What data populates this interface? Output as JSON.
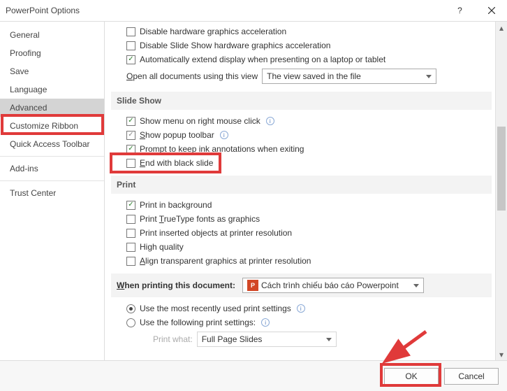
{
  "window": {
    "title": "PowerPoint Options"
  },
  "sidebar": {
    "items": [
      "General",
      "Proofing",
      "Save",
      "Language",
      "Advanced",
      "Customize Ribbon",
      "Quick Access Toolbar",
      "Add-ins",
      "Trust Center"
    ],
    "selected": "Advanced"
  },
  "top": {
    "disable_hw": "Disable hardware graphics acceleration",
    "disable_ss_hw": "Disable Slide Show hardware graphics acceleration",
    "auto_extend": "Automatically extend display when presenting on a laptop or tablet",
    "open_view_label_pre": "O",
    "open_view_label_rest": "pen all documents using this view",
    "open_view_value": "The view saved in the file"
  },
  "slide_show": {
    "header": "Slide Show",
    "show_menu": "Show menu on right mouse click",
    "popup_pre": "S",
    "popup_rest": "how popup toolbar",
    "prompt_ink": "Prompt to keep ink annotations when exiting",
    "end_black_pre": "E",
    "end_black_rest": "nd with black slide"
  },
  "print": {
    "header": "Print",
    "bg": "Print in background",
    "tt_pre": "Print ",
    "tt_u": "T",
    "tt_rest": "rueType fonts as graphics",
    "inserted": "Print inserted objects at printer resolution",
    "hq": "High quality",
    "align_pre": "A",
    "align_rest": "lign transparent graphics at printer resolution",
    "when_pre": "W",
    "when_rest": "hen printing this document:",
    "doc_name": "Cách trình chiếu báo cáo Powerpoint",
    "use_recent": "Use the most recently used print settings",
    "use_following": "Use the following print settings:",
    "print_what_label": "Print what:",
    "print_what_value": "Full Page Slides"
  },
  "buttons": {
    "ok": "OK",
    "cancel": "Cancel"
  }
}
